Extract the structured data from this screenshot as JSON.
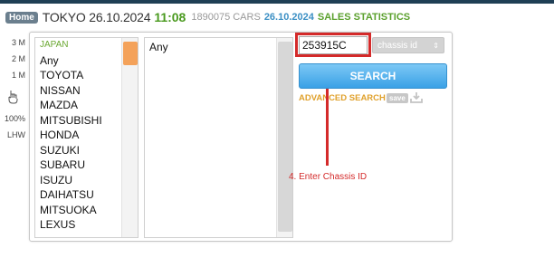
{
  "header": {
    "home_label": "Home",
    "city_date": "TOKYO 26.10.2024",
    "time": "11:08",
    "count": "1890075 CARS",
    "sales_date": "26.10.2024",
    "sales_label": "SALES STATISTICS"
  },
  "side": {
    "items": [
      "3 M",
      "2 M",
      "1 M",
      "100%",
      "LHW"
    ],
    "hand_icon": "hand-pointer-icon"
  },
  "makers": {
    "items": [
      "JAPAN",
      "Any",
      "TOYOTA",
      "NISSAN",
      "MAZDA",
      "MITSUBISHI",
      "HONDA",
      "SUZUKI",
      "SUBARU",
      "ISUZU",
      "DAIHATSU",
      "MITSUOKA",
      "LEXUS"
    ]
  },
  "models": {
    "items": [
      "Any"
    ]
  },
  "search": {
    "chassis_value": "253915C",
    "field_select": "chassis id",
    "search_label": "SEARCH",
    "advanced_label": "ADVANCED SEARCH",
    "save_label": "save",
    "download_icon": "download-icon"
  },
  "annotation": {
    "note": "4. Enter Chassis ID"
  },
  "colors": {
    "accent_red": "#d42a2a",
    "search_blue": "#3aa1e6",
    "green": "#4a9a1f"
  }
}
